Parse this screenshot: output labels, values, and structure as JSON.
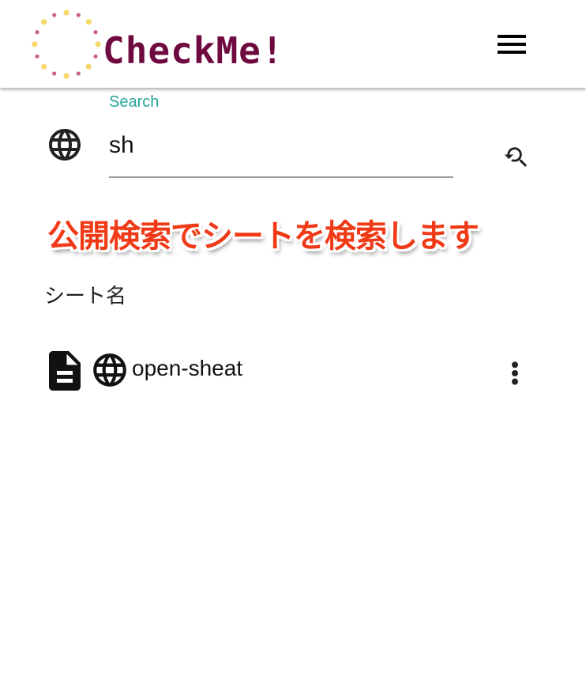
{
  "header": {
    "logo_text": "CheckMe!",
    "logo_color": "#6e0a3f",
    "logo_dot_colors": [
      "#f7d86a",
      "#c95f8a"
    ],
    "menu_icon": "hamburger-icon"
  },
  "search": {
    "label": "Search",
    "value": "sh",
    "label_color": "#26a69a",
    "scope_icon": "globe-icon",
    "action_icon": "refresh-search-icon"
  },
  "annotation": {
    "text": "公開検索でシートを検索します",
    "color": "#f03a17"
  },
  "list": {
    "column_header": "シート名",
    "items": [
      {
        "name": "open-sheat",
        "type_icon": "document-icon",
        "visibility_icon": "globe-icon",
        "menu_icon": "more-vert-icon"
      }
    ]
  }
}
